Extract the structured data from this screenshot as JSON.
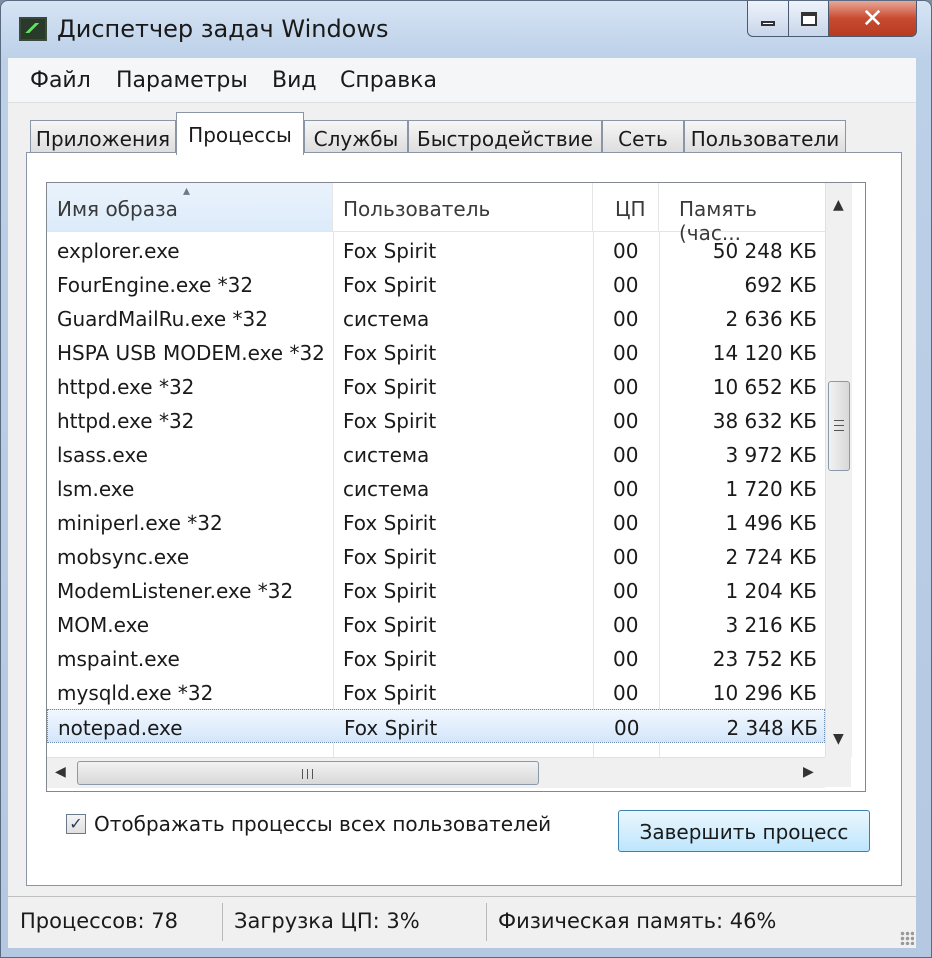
{
  "window": {
    "title": "Диспетчер задач Windows",
    "close_glyph": "✕"
  },
  "menu": {
    "items": [
      {
        "label": "Файл"
      },
      {
        "label": "Параметры"
      },
      {
        "label": "Вид"
      },
      {
        "label": "Справка"
      }
    ]
  },
  "tabs": [
    {
      "label": "Приложения"
    },
    {
      "label": "Процессы"
    },
    {
      "label": "Службы"
    },
    {
      "label": "Быстродействие"
    },
    {
      "label": "Сеть"
    },
    {
      "label": "Пользователи"
    }
  ],
  "active_tab": "Процессы",
  "columns": {
    "name": "Имя образа",
    "user": "Пользователь",
    "cpu": "ЦП",
    "mem": "Память (час..."
  },
  "sort_glyph": "▴",
  "processes": [
    {
      "name": "explorer.exe",
      "user": "Fox Spirit",
      "cpu": "00",
      "mem": "50 248 КБ"
    },
    {
      "name": "FourEngine.exe *32",
      "user": "Fox Spirit",
      "cpu": "00",
      "mem": "692 КБ"
    },
    {
      "name": "GuardMailRu.exe *32",
      "user": "система",
      "cpu": "00",
      "mem": "2 636 КБ"
    },
    {
      "name": "HSPA USB MODEM.exe *32",
      "user": "Fox Spirit",
      "cpu": "00",
      "mem": "14 120 КБ"
    },
    {
      "name": "httpd.exe *32",
      "user": "Fox Spirit",
      "cpu": "00",
      "mem": "10 652 КБ"
    },
    {
      "name": "httpd.exe *32",
      "user": "Fox Spirit",
      "cpu": "00",
      "mem": "38 632 КБ"
    },
    {
      "name": "lsass.exe",
      "user": "система",
      "cpu": "00",
      "mem": "3 972 КБ"
    },
    {
      "name": "lsm.exe",
      "user": "система",
      "cpu": "00",
      "mem": "1 720 КБ"
    },
    {
      "name": "miniperl.exe *32",
      "user": "Fox Spirit",
      "cpu": "00",
      "mem": "1 496 КБ"
    },
    {
      "name": "mobsync.exe",
      "user": "Fox Spirit",
      "cpu": "00",
      "mem": "2 724 КБ"
    },
    {
      "name": "ModemListener.exe *32",
      "user": "Fox Spirit",
      "cpu": "00",
      "mem": "1 204 КБ"
    },
    {
      "name": "MOM.exe",
      "user": "Fox Spirit",
      "cpu": "00",
      "mem": "3 216 КБ"
    },
    {
      "name": "mspaint.exe",
      "user": "Fox Spirit",
      "cpu": "00",
      "mem": "23 752 КБ"
    },
    {
      "name": "mysqld.exe *32",
      "user": "Fox Spirit",
      "cpu": "00",
      "mem": "10 296 КБ"
    },
    {
      "name": "notepad.exe",
      "user": "Fox Spirit",
      "cpu": "00",
      "mem": "2 348 КБ"
    }
  ],
  "selected_process": "notepad.exe",
  "show_all_users": {
    "label": "Отображать процессы всех пользователей",
    "checked": true,
    "check_glyph": "✓"
  },
  "end_process_button": {
    "label": "Завершить процесс"
  },
  "status": {
    "processes": "Процессов: 78",
    "cpu": "Загрузка ЦП: 3%",
    "memory": "Физическая память: 46%"
  },
  "scroll": {
    "up_glyph": "▲",
    "down_glyph": "▼",
    "left_glyph": "◀",
    "right_glyph": "▶"
  }
}
